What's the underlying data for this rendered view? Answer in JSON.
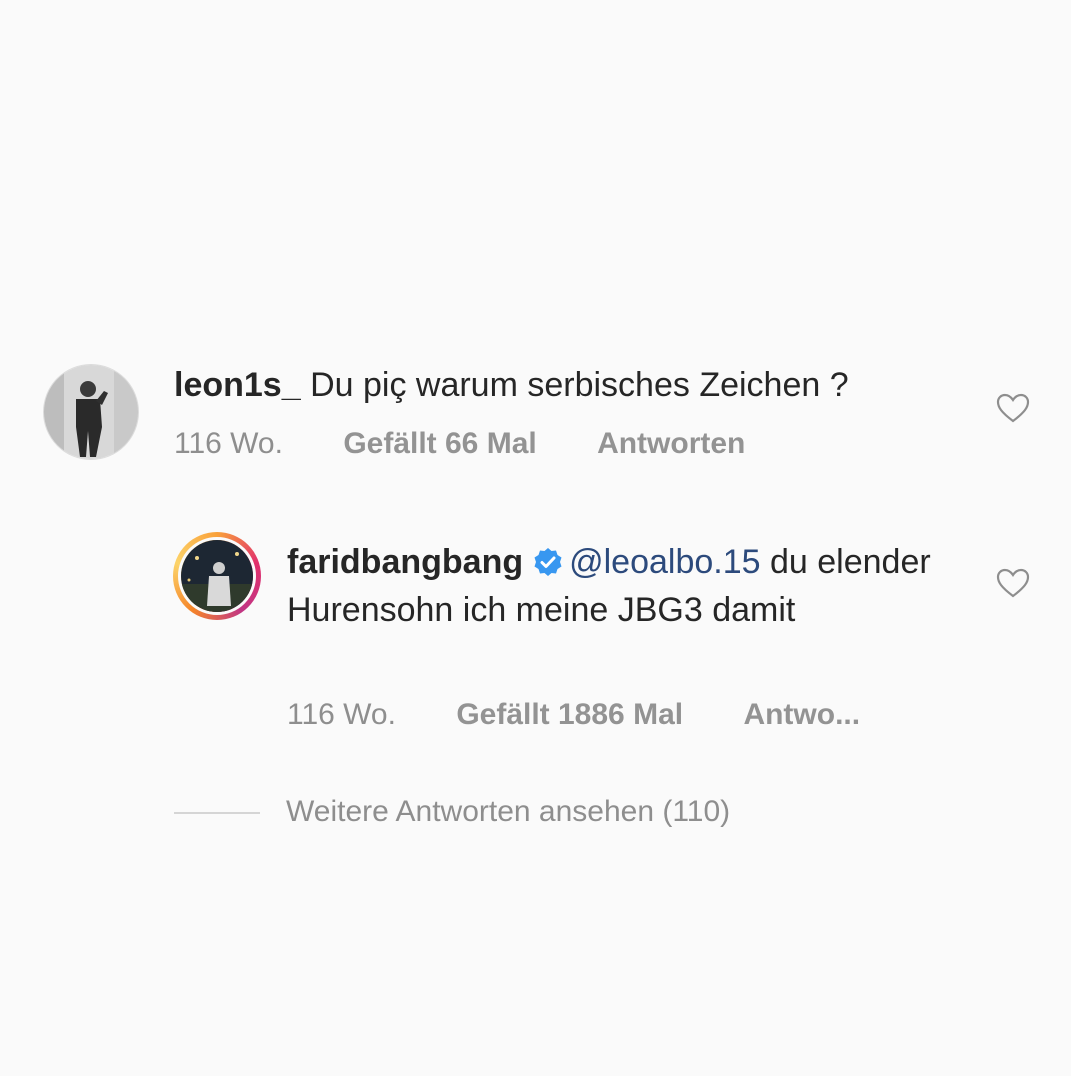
{
  "comments": [
    {
      "username": "leon1s_",
      "text": "Du piç warum serbisches Zeichen ?",
      "time": "116 Wo.",
      "likes": "Gefällt 66 Mal",
      "reply": "Antworten"
    },
    {
      "username": "faridbangbang",
      "verified": true,
      "mention": "@leoalbo.15",
      "text": "du elender Hurensohn ich meine JBG3 damit",
      "time": "116 Wo.",
      "likes": "Gefällt 1886 Mal",
      "reply": "Antwo..."
    }
  ],
  "more_replies": "Weitere Antworten ansehen (110)",
  "colors": {
    "mention": "#2c4a7c",
    "verified": "#3897f0",
    "meta": "#8e8e8e"
  },
  "icons": [
    "heart-icon",
    "verified-badge-icon"
  ]
}
